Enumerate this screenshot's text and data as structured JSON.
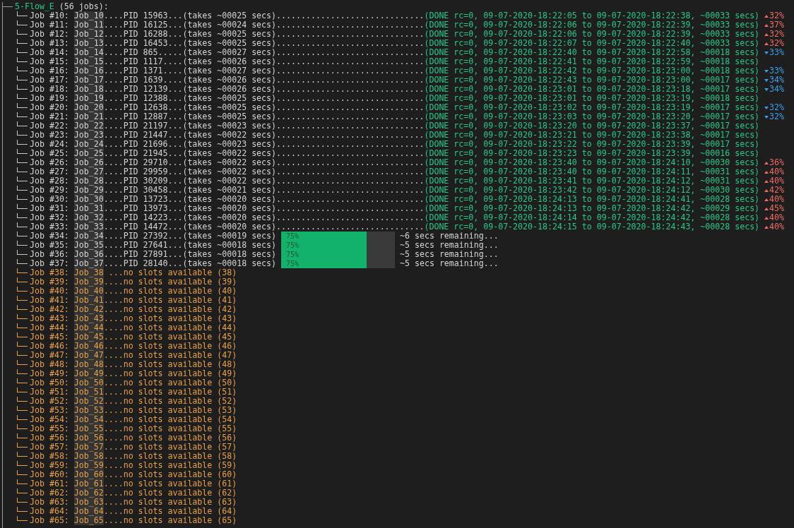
{
  "flow": {
    "name": "5-Flow_E",
    "count": "(56 jobs):"
  },
  "jobs": [
    {
      "kind": "done",
      "label": "Job #10:",
      "name": "Job_10",
      "detail": "....PID 15963...(takes ~00025 secs)",
      "leader": "..............................",
      "result": "(DONE rc=0, 09-07-2020-18:22:05 to 09-07-2020-18:22:38, ~00033 secs)",
      "change": {
        "rising": true,
        "text": "32%"
      }
    },
    {
      "kind": "done",
      "label": "Job #11:",
      "name": "Job_11",
      "detail": "....PID 16125...(takes ~00024 secs)",
      "leader": "..............................",
      "result": "(DONE rc=0, 09-07-2020-18:22:06 to 09-07-2020-18:22:39, ~00033 secs)",
      "change": {
        "rising": true,
        "text": "37%"
      }
    },
    {
      "kind": "done",
      "label": "Job #12:",
      "name": "Job_12",
      "detail": "....PID 16288...(takes ~00025 secs)",
      "leader": "..............................",
      "result": "(DONE rc=0, 09-07-2020-18:22:06 to 09-07-2020-18:22:39, ~00033 secs)",
      "change": {
        "rising": true,
        "text": "32%"
      }
    },
    {
      "kind": "done",
      "label": "Job #13:",
      "name": "Job_13",
      "detail": "....PID 16453...(takes ~00025 secs)",
      "leader": "..............................",
      "result": "(DONE rc=0, 09-07-2020-18:22:07 to 09-07-2020-18:22:40, ~00033 secs)",
      "change": {
        "rising": true,
        "text": "32%"
      }
    },
    {
      "kind": "done",
      "label": "Job #14:",
      "name": "Job_14",
      "detail": "....PID 865.....(takes ~00027 secs)",
      "leader": "..............................",
      "result": "(DONE rc=0, 09-07-2020-18:22:40 to 09-07-2020-18:22:58, ~00018 secs)",
      "change": {
        "rising": false,
        "text": "33%"
      }
    },
    {
      "kind": "done",
      "label": "Job #15:",
      "name": "Job_15",
      "detail": "....PID 1117....(takes ~00026 secs)",
      "leader": "..............................",
      "result": "(DONE rc=0, 09-07-2020-18:22:41 to 09-07-2020-18:22:59, ~00018 secs)"
    },
    {
      "kind": "done",
      "label": "Job #16:",
      "name": "Job_16",
      "detail": "....PID 1371....(takes ~00027 secs)",
      "leader": "..............................",
      "result": "(DONE rc=0, 09-07-2020-18:22:42 to 09-07-2020-18:23:00, ~00018 secs)",
      "change": {
        "rising": false,
        "text": "33%"
      }
    },
    {
      "kind": "done",
      "label": "Job #17:",
      "name": "Job_17",
      "detail": "....PID 1639....(takes ~00026 secs)",
      "leader": "..............................",
      "result": "(DONE rc=0, 09-07-2020-18:22:43 to 09-07-2020-18:23:00, ~00017 secs)",
      "change": {
        "rising": false,
        "text": "34%"
      }
    },
    {
      "kind": "done",
      "label": "Job #18:",
      "name": "Job_18",
      "detail": "....PID 12139...(takes ~00026 secs)",
      "leader": "..............................",
      "result": "(DONE rc=0, 09-07-2020-18:23:01 to 09-07-2020-18:23:18, ~00017 secs)",
      "change": {
        "rising": false,
        "text": "34%"
      }
    },
    {
      "kind": "done",
      "label": "Job #19:",
      "name": "Job_19",
      "detail": "....PID 12388...(takes ~00025 secs)",
      "leader": "..............................",
      "result": "(DONE rc=0, 09-07-2020-18:23:01 to 09-07-2020-18:23:19, ~00018 secs)"
    },
    {
      "kind": "done",
      "label": "Job #20:",
      "name": "Job_20",
      "detail": "....PID 12638...(takes ~00025 secs)",
      "leader": "..............................",
      "result": "(DONE rc=0, 09-07-2020-18:23:02 to 09-07-2020-18:23:19, ~00017 secs)",
      "change": {
        "rising": false,
        "text": "32%"
      }
    },
    {
      "kind": "done",
      "label": "Job #21:",
      "name": "Job_21",
      "detail": "....PID 12887...(takes ~00025 secs)",
      "leader": "..............................",
      "result": "(DONE rc=0, 09-07-2020-18:23:03 to 09-07-2020-18:23:20, ~00017 secs)",
      "change": {
        "rising": false,
        "text": "32%"
      }
    },
    {
      "kind": "done",
      "label": "Job #22:",
      "name": "Job_22",
      "detail": "....PID 21197...(takes ~00023 secs)",
      "leader": "..............................",
      "result": "(DONE rc=0, 09-07-2020-18:23:20 to 09-07-2020-18:23:37, ~00017 secs)"
    },
    {
      "kind": "done",
      "label": "Job #23:",
      "name": "Job_23",
      "detail": "....PID 21447...(takes ~00022 secs)",
      "leader": "..............................",
      "result": "(DONE rc=0, 09-07-2020-18:23:21 to 09-07-2020-18:23:38, ~00017 secs)"
    },
    {
      "kind": "done",
      "label": "Job #24:",
      "name": "Job_24",
      "detail": "....PID 21696...(takes ~00023 secs)",
      "leader": "..............................",
      "result": "(DONE rc=0, 09-07-2020-18:23:22 to 09-07-2020-18:23:39, ~00017 secs)"
    },
    {
      "kind": "done",
      "label": "Job #25:",
      "name": "Job_25",
      "detail": "....PID 21945...(takes ~00022 secs)",
      "leader": "..............................",
      "result": "(DONE rc=0, 09-07-2020-18:23:23 to 09-07-2020-18:23:39, ~00016 secs)"
    },
    {
      "kind": "done",
      "label": "Job #26:",
      "name": "Job_26",
      "detail": "....PID 29710...(takes ~00022 secs)",
      "leader": "..............................",
      "result": "(DONE rc=0, 09-07-2020-18:23:40 to 09-07-2020-18:24:10, ~00030 secs)",
      "change": {
        "rising": true,
        "text": "36%"
      }
    },
    {
      "kind": "done",
      "label": "Job #27:",
      "name": "Job_27",
      "detail": "....PID 29959...(takes ~00022 secs)",
      "leader": "..............................",
      "result": "(DONE rc=0, 09-07-2020-18:23:40 to 09-07-2020-18:24:11, ~00031 secs)",
      "change": {
        "rising": true,
        "text": "40%"
      }
    },
    {
      "kind": "done",
      "label": "Job #28:",
      "name": "Job_28",
      "detail": "....PID 30209...(takes ~00022 secs)",
      "leader": "..............................",
      "result": "(DONE rc=0, 09-07-2020-18:23:41 to 09-07-2020-18:24:12, ~00031 secs)",
      "change": {
        "rising": true,
        "text": "40%"
      }
    },
    {
      "kind": "done",
      "label": "Job #29:",
      "name": "Job_29",
      "detail": "....PID 30458...(takes ~00021 secs)",
      "leader": "..............................",
      "result": "(DONE rc=0, 09-07-2020-18:23:42 to 09-07-2020-18:24:12, ~00030 secs)",
      "change": {
        "rising": true,
        "text": "42%"
      }
    },
    {
      "kind": "done",
      "label": "Job #30:",
      "name": "Job_30",
      "detail": "....PID 13723...(takes ~00020 secs)",
      "leader": "..............................",
      "result": "(DONE rc=0, 09-07-2020-18:24:13 to 09-07-2020-18:24:41, ~00028 secs)",
      "change": {
        "rising": true,
        "text": "40%"
      }
    },
    {
      "kind": "done",
      "label": "Job #31:",
      "name": "Job_31",
      "detail": "....PID 13973...(takes ~00020 secs)",
      "leader": "..............................",
      "result": "(DONE rc=0, 09-07-2020-18:24:13 to 09-07-2020-18:24:42, ~00029 secs)",
      "change": {
        "rising": true,
        "text": "45%"
      }
    },
    {
      "kind": "done",
      "label": "Job #32:",
      "name": "Job_32",
      "detail": "....PID 14223...(takes ~00020 secs)",
      "leader": "..............................",
      "result": "(DONE rc=0, 09-07-2020-18:24:14 to 09-07-2020-18:24:42, ~00028 secs)",
      "change": {
        "rising": true,
        "text": "40%"
      }
    },
    {
      "kind": "done",
      "label": "Job #33:",
      "name": "Job_33",
      "detail": "....PID 14472...(takes ~00020 secs)",
      "leader": "..............................",
      "result": "(DONE rc=0, 09-07-2020-18:24:15 to 09-07-2020-18:24:43, ~00028 secs)",
      "change": {
        "rising": true,
        "text": "40%"
      }
    },
    {
      "kind": "running",
      "label": "Job #34:",
      "name": "Job_34",
      "detail": "....PID 27392...(takes ~00019 secs)",
      "level": 0.75,
      "percent": "75%",
      "remaining": "~6 secs remaining..."
    },
    {
      "kind": "running",
      "label": "Job #35:",
      "name": "Job_35",
      "detail": "....PID 27641...(takes ~00018 secs)",
      "level": 0.75,
      "percent": "75%",
      "remaining": "~5 secs remaining..."
    },
    {
      "kind": "running",
      "label": "Job #36:",
      "name": "Job_36",
      "detail": "....PID 27891...(takes ~00018 secs)",
      "level": 0.75,
      "percent": "75%",
      "remaining": "~5 secs remaining..."
    },
    {
      "kind": "running",
      "label": "Job #37:",
      "name": "Job_37",
      "detail": "....PID 28140...(takes ~00018 secs)",
      "level": 0.75,
      "percent": "75%",
      "remaining": "~5 secs remaining..."
    },
    {
      "kind": "waiting",
      "label": "Job #38:",
      "name": "Job_38",
      "detail": " ...no slots available (38)"
    },
    {
      "kind": "waiting",
      "label": "Job #39:",
      "name": "Job_39",
      "detail": "....no slots available (39)"
    },
    {
      "kind": "waiting",
      "label": "Job #40:",
      "name": "Job_40",
      "detail": "....no slots available (40)"
    },
    {
      "kind": "waiting",
      "label": "Job #41:",
      "name": "Job_41",
      "detail": "....no slots available (41)"
    },
    {
      "kind": "waiting",
      "label": "Job #42:",
      "name": "Job_42",
      "detail": "....no slots available (42)"
    },
    {
      "kind": "waiting",
      "label": "Job #43:",
      "name": "Job_43",
      "detail": "....no slots available (43)"
    },
    {
      "kind": "waiting",
      "label": "Job #44:",
      "name": "Job_44",
      "detail": "....no slots available (44)"
    },
    {
      "kind": "waiting",
      "label": "Job #45:",
      "name": "Job_45",
      "detail": "....no slots available (45)"
    },
    {
      "kind": "waiting",
      "label": "Job #46:",
      "name": "Job_46",
      "detail": "....no slots available (46)"
    },
    {
      "kind": "waiting",
      "label": "Job #47:",
      "name": "Job_47",
      "detail": "....no slots available (47)"
    },
    {
      "kind": "waiting",
      "label": "Job #48:",
      "name": "Job_48",
      "detail": "....no slots available (48)"
    },
    {
      "kind": "waiting",
      "label": "Job #49:",
      "name": "Job_49",
      "detail": "....no slots available (49)"
    },
    {
      "kind": "waiting",
      "label": "Job #50:",
      "name": "Job_50",
      "detail": "....no slots available (50)"
    },
    {
      "kind": "waiting",
      "label": "Job #51:",
      "name": "Job_51",
      "detail": "....no slots available (51)"
    },
    {
      "kind": "waiting",
      "label": "Job #52:",
      "name": "Job_52",
      "detail": "....no slots available (52)"
    },
    {
      "kind": "waiting",
      "label": "Job #53:",
      "name": "Job_53",
      "detail": "....no slots available (53)"
    },
    {
      "kind": "waiting",
      "label": "Job #54:",
      "name": "Job_54",
      "detail": "....no slots available (54)"
    },
    {
      "kind": "waiting",
      "label": "Job #55:",
      "name": "Job_55",
      "detail": "....no slots available (55)"
    },
    {
      "kind": "waiting",
      "label": "Job #56:",
      "name": "Job_56",
      "detail": "....no slots available (56)"
    },
    {
      "kind": "waiting",
      "label": "Job #57:",
      "name": "Job_57",
      "detail": "....no slots available (57)"
    },
    {
      "kind": "waiting",
      "label": "Job #58:",
      "name": "Job_58",
      "detail": "....no slots available (58)"
    },
    {
      "kind": "waiting",
      "label": "Job #59:",
      "name": "Job_59",
      "detail": "....no slots available (59)"
    },
    {
      "kind": "waiting",
      "label": "Job #60:",
      "name": "Job_60",
      "detail": "....no slots available (60)"
    },
    {
      "kind": "waiting",
      "label": "Job #61:",
      "name": "Job_61",
      "detail": "....no slots available (61)"
    },
    {
      "kind": "waiting",
      "label": "Job #62:",
      "name": "Job_62",
      "detail": "....no slots available (62)"
    },
    {
      "kind": "waiting",
      "label": "Job #63:",
      "name": "Job_63",
      "detail": "....no slots available (63)"
    },
    {
      "kind": "waiting",
      "label": "Job #64:",
      "name": "Job_64",
      "detail": "....no slots available (64)"
    },
    {
      "kind": "waiting",
      "label": "Job #65:",
      "name": "Job_65",
      "detail": "....no slots available (65)"
    }
  ]
}
